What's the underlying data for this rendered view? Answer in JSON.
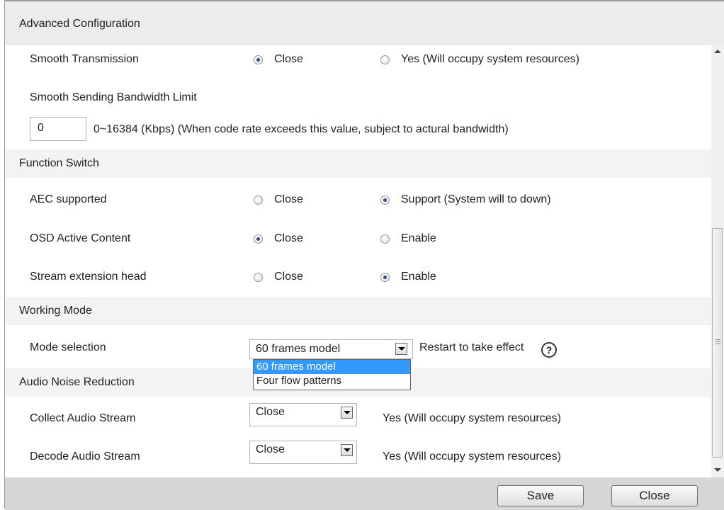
{
  "title": "Advanced Configuration",
  "smooth": {
    "label": "Smooth Transmission",
    "opt_close": "Close",
    "opt_yes": "Yes (Will occupy system resources)",
    "selected": "Close",
    "bandwidth_label": "Smooth Sending Bandwidth Limit",
    "bandwidth_value": "0",
    "bandwidth_hint": "0~16384  (Kbps) (When code rate exceeds this value, subject to actural bandwidth)"
  },
  "function_switch": {
    "header": "Function Switch",
    "aec": {
      "label": "AEC supported",
      "opt_close": "Close",
      "opt_other": "Support (System will to down)",
      "selected": "Support (System will to down)"
    },
    "osd": {
      "label": "OSD Active Content",
      "opt_close": "Close",
      "opt_other": "Enable",
      "selected": "Close"
    },
    "stream_ext": {
      "label": "Stream extension head",
      "opt_close": "Close",
      "opt_other": "Enable",
      "selected": "Enable"
    }
  },
  "working_mode": {
    "header": "Working Mode",
    "label": "Mode selection",
    "value": "60 frames model",
    "options": [
      "60 frames model",
      "Four flow patterns"
    ],
    "note": "Restart to take effect"
  },
  "audio": {
    "header": "Audio Noise Reduction",
    "collect": {
      "label": "Collect Audio Stream",
      "value": "Close",
      "note": "Yes (Will occupy system resources)"
    },
    "decode": {
      "label": "Decode Audio Stream",
      "value": "Close",
      "note": "Yes (Will occupy system resources)"
    }
  },
  "footer": {
    "save": "Save",
    "close": "Close"
  },
  "icons": {
    "help": "help-icon",
    "dropdown": "chevron-down-icon"
  }
}
